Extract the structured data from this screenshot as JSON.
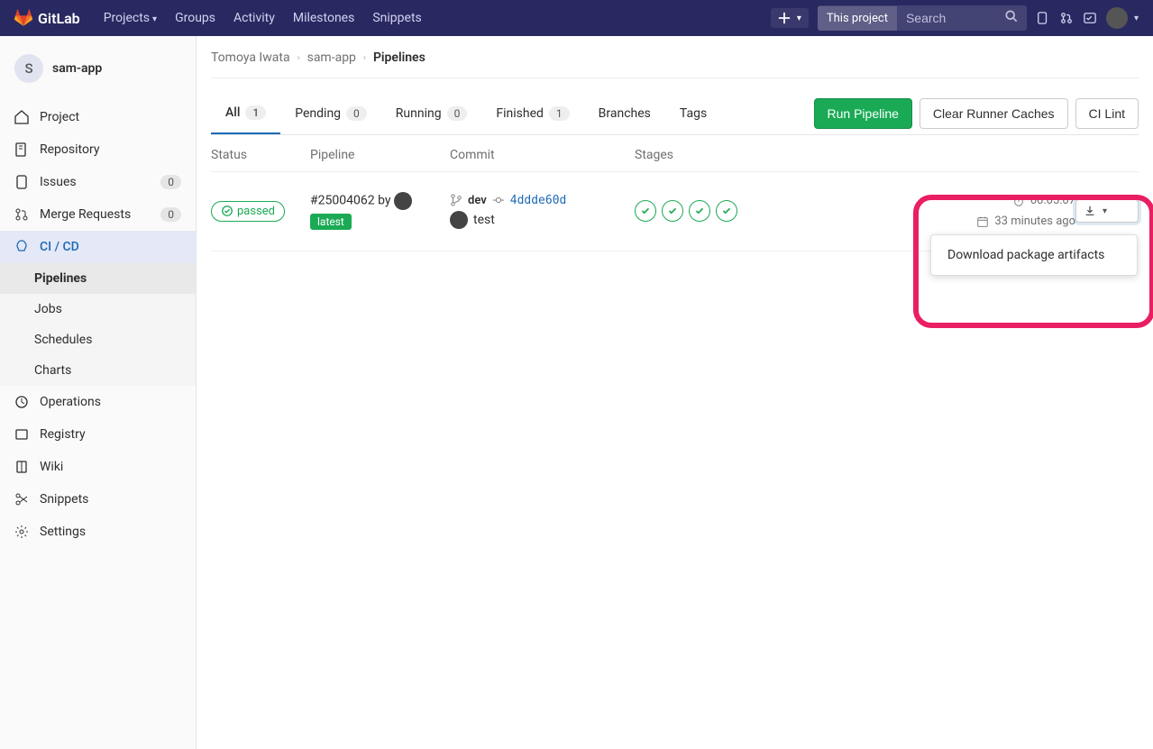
{
  "topnav": {
    "brand": "GitLab",
    "links": {
      "projects": "Projects",
      "groups": "Groups",
      "activity": "Activity",
      "milestones": "Milestones",
      "snippets": "Snippets"
    },
    "search_scope": "This project",
    "search_placeholder": "Search"
  },
  "sidebar": {
    "project_initial": "S",
    "project_name": "sam-app",
    "items": {
      "project": "Project",
      "repository": "Repository",
      "issues": "Issues",
      "issues_count": "0",
      "mr": "Merge Requests",
      "mr_count": "0",
      "cicd": "CI / CD",
      "operations": "Operations",
      "registry": "Registry",
      "wiki": "Wiki",
      "snippets": "Snippets",
      "settings": "Settings"
    },
    "sub": {
      "pipelines": "Pipelines",
      "jobs": "Jobs",
      "schedules": "Schedules",
      "charts": "Charts"
    }
  },
  "breadcrumbs": {
    "owner": "Tomoya Iwata",
    "project": "sam-app",
    "page": "Pipelines"
  },
  "tabs": {
    "all": "All",
    "all_count": "1",
    "pending": "Pending",
    "pending_count": "0",
    "running": "Running",
    "running_count": "0",
    "finished": "Finished",
    "finished_count": "1",
    "branches": "Branches",
    "tags": "Tags"
  },
  "actions": {
    "run": "Run Pipeline",
    "clear": "Clear Runner Caches",
    "lint": "CI Lint"
  },
  "columns": {
    "status": "Status",
    "pipeline": "Pipeline",
    "commit": "Commit",
    "stages": "Stages"
  },
  "row": {
    "status": "passed",
    "id": "#25004062",
    "by": "by",
    "latest": "latest",
    "branch": "dev",
    "sha": "4ddde60d",
    "message": "test",
    "duration": "00:05:07",
    "finished": "33 minutes ago"
  },
  "dropdown": {
    "download_package": "Download package artifacts"
  }
}
